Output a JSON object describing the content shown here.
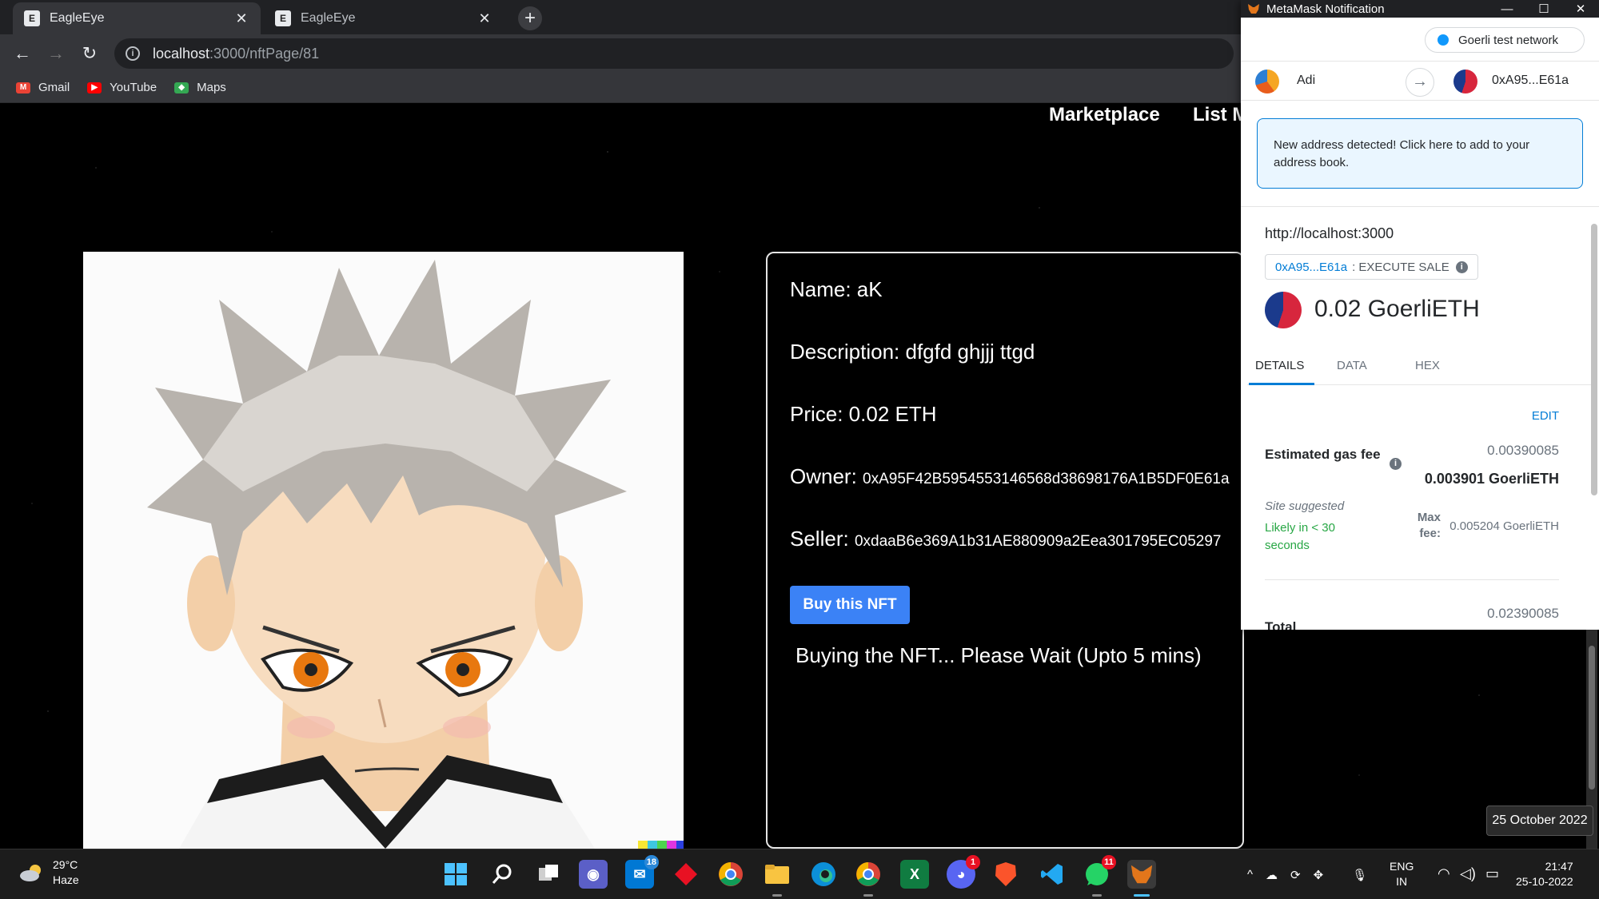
{
  "browser": {
    "tabs": [
      {
        "title": "EagleEye",
        "active": true
      },
      {
        "title": "EagleEye",
        "active": false
      }
    ],
    "new_tab": "+",
    "url_host": "localhost",
    "url_path": ":3000/nftPage/81",
    "bookmarks": [
      "Gmail",
      "YouTube",
      "Maps"
    ]
  },
  "site_nav": {
    "marketplace": "Marketplace",
    "list": "List M"
  },
  "nft": {
    "name_line": "Name: aK",
    "description_line": "Description: dfgfd ghjjj ttgd",
    "price_line": "Price: 0.02 ETH",
    "owner_label": "Owner:",
    "owner_value": "0xA95F42B5954553146568d38698176A1B5DF0E61a",
    "seller_label": "Seller:",
    "seller_value": "0xdaaB6e369A1b31AE880909a2Eea301795EC05297",
    "buy_button": "Buy this NFT",
    "status": "Buying the NFT... Please Wait (Upto 5 mins)"
  },
  "metamask": {
    "window_title": "MetaMask Notification",
    "window_controls": [
      "—",
      "☐",
      "✕"
    ],
    "network": "Goerli test network",
    "from_account": "Adi",
    "to_account": "0xA95...E61a",
    "alert": "New address detected! Click here to add to your address book.",
    "origin": "http://localhost:3000",
    "method_address": "0xA95...E61a",
    "method_name": ": EXECUTE SALE",
    "amount": "0.02 GoerliETH",
    "tabs": [
      "DETAILS",
      "DATA",
      "HEX"
    ],
    "edit": "EDIT",
    "gas_label": "Estimated gas fee",
    "gas_value": "0.00390085",
    "gas_eth": "0.003901 GoerliETH",
    "site_suggested": "Site suggested",
    "likely": "Likely in < 30 seconds",
    "max_fee_label": "Max fee:",
    "max_fee_value": "0.005204 GoerliETH",
    "total_label": "Total",
    "total_value": "0.02390085"
  },
  "tooltip_date": "25 October 2022",
  "taskbar": {
    "weather_temp": "29°C",
    "weather_desc": "Haze",
    "mail_badge": "18",
    "discord_badge": "1",
    "whatsapp_badge": "11",
    "lang_line1": "ENG",
    "lang_line2": "IN",
    "time": "21:47",
    "date": "25-10-2022"
  },
  "colors": {
    "buy_button": "#3b82f6",
    "metamask_link": "#037dd6",
    "likely_green": "#28a745"
  }
}
